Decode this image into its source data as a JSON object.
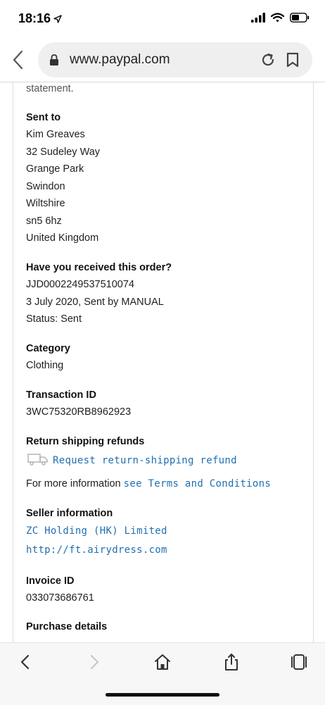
{
  "status": {
    "time": "18:16"
  },
  "browser": {
    "url": "www.paypal.com"
  },
  "details": {
    "statement_tail": "statement.",
    "sent_to": {
      "heading": "Sent to",
      "lines": [
        "Kim Greaves",
        "32 Sudeley Way",
        "Grange Park",
        "Swindon",
        "Wiltshire",
        "sn5 6hz",
        "United Kingdom"
      ]
    },
    "order": {
      "heading": "Have you received this order?",
      "tracking": "JJD0002249537510074",
      "sent_info": "3 July 2020, Sent by MANUAL",
      "status": "Status: Sent"
    },
    "category": {
      "heading": "Category",
      "value": "Clothing"
    },
    "transaction": {
      "heading": "Transaction ID",
      "value": "3WC75320RB8962923"
    },
    "returns": {
      "heading": "Return shipping refunds",
      "link": "Request return-shipping refund",
      "more_prefix": "For more information",
      "more_link": "see Terms and Conditions"
    },
    "seller": {
      "heading": "Seller information",
      "name": "ZC Holding (HK) Limited",
      "website": "http://ft.airydress.com"
    },
    "invoice": {
      "heading": "Invoice ID",
      "value": "033073686761"
    },
    "purchase": {
      "heading": "Purchase details"
    }
  }
}
